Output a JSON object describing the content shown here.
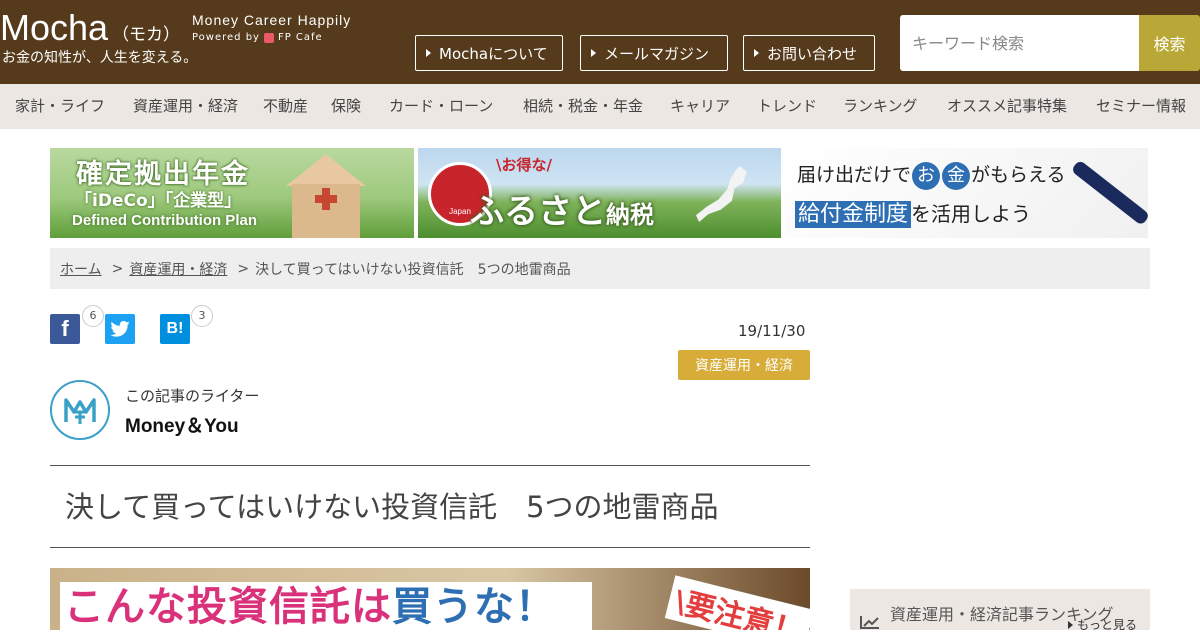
{
  "header": {
    "logo": "Mocha",
    "logo_kana": "（モカ）",
    "tagline": "お金の知性が、人生を変える。",
    "slogan": "Money Career Happily",
    "powered_by": "Powered by",
    "powered_brand": "FP Cafe",
    "buttons": [
      "Mochaについて",
      "メールマガジン",
      "お問い合わせ"
    ],
    "search": {
      "placeholder": "キーワード検索",
      "button": "検索"
    }
  },
  "nav": {
    "items": [
      "家計・ライフ",
      "資産運用・経済",
      "不動産",
      "保険",
      "カード・ローン",
      "相続・税金・年金",
      "キャリア",
      "トレンド",
      "ランキング",
      "オススメ記事特集",
      "セミナー情報"
    ]
  },
  "banners": {
    "ideco": {
      "title": "確定拠出年金",
      "sub": "「iDeCo」「企業型」",
      "en": "Defined Contribution Plan"
    },
    "furusato": {
      "badge": "\\お得な/",
      "seal": "Japan",
      "title_a": "ふるさと",
      "title_b": "納税"
    },
    "kyufukin": {
      "line1_a": "届け出だけで",
      "circle1": "お",
      "circle2": "金",
      "line1_b": "がもらえる",
      "highlight": "給付金制度",
      "line2": "を活用しよう"
    }
  },
  "breadcrumb": {
    "home": "ホーム",
    "sep1": ">",
    "category": "資産運用・経済",
    "sep2": ">",
    "current": "決して買ってはいけない投資信託　5つの地雷商品"
  },
  "social": {
    "facebook_count": "6",
    "hatena_count": "3"
  },
  "article": {
    "date": "19/11/30",
    "category": "資産運用・経済",
    "writer_label": "この記事のライター",
    "writer_name": "Money＆You",
    "title": "決して買ってはいけない投資信託　5つの地雷商品",
    "hero_text_a": "こんな投資信託は",
    "hero_text_b": "買うな！",
    "hero_caution": "\\要注意！"
  },
  "sidebar": {
    "ranking_title": "資産運用・経済記事ランキング",
    "more": "もっと見る"
  },
  "colors": {
    "header_bg": "#553a1b",
    "nav_bg": "#ece7e2",
    "search_button": "#b9a837",
    "category_badge": "#d7ac38",
    "facebook": "#3b5998",
    "twitter": "#1da1f2",
    "hatena": "#008fde"
  }
}
